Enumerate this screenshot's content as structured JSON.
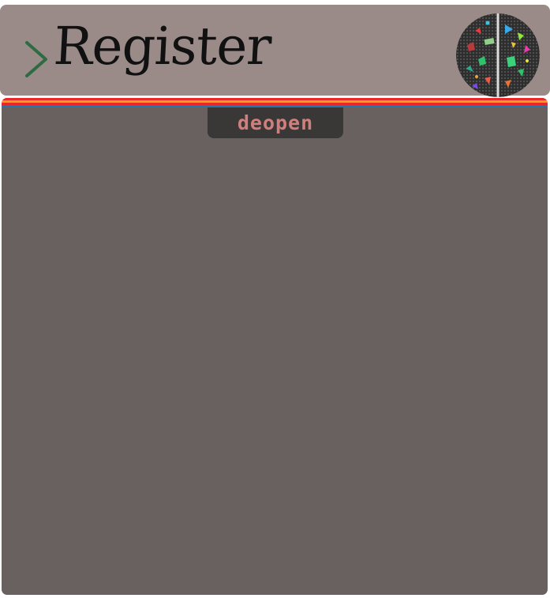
{
  "header": {
    "title": "Register",
    "chevron_icon": "chevron-right-icon",
    "logo_icon": "brain-mosaic-logo-icon"
  },
  "brand": {
    "label": "deopen"
  },
  "colors": {
    "header_bg": "#9a8b89",
    "panel_bg": "#696160",
    "chevron": "#2e6b43",
    "stripes": [
      "#e8282a",
      "#f39b1c",
      "#e8282a",
      "#2a74a8"
    ],
    "brand_tab_bg": "#3a3737",
    "brand_text": "#d07f7c"
  }
}
